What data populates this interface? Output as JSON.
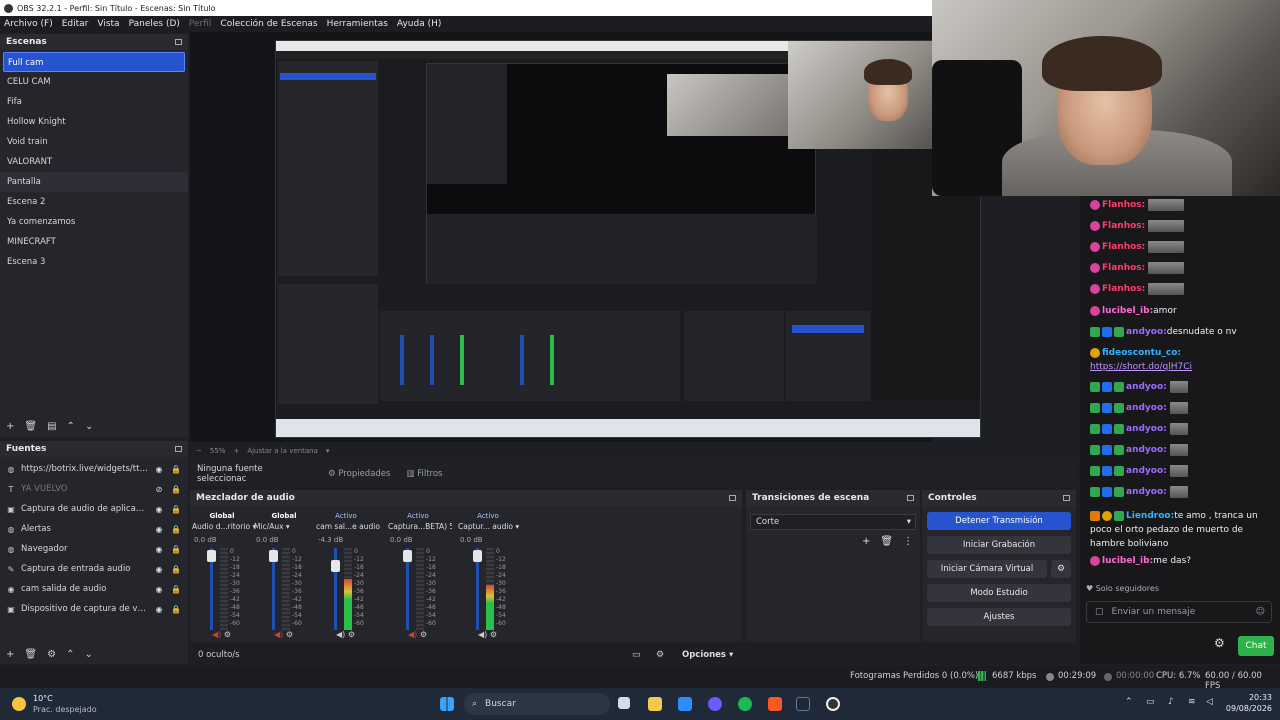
{
  "window": {
    "title": "OBS 32.2.1 - Perfil: Sin Título - Escenas: Sin Título"
  },
  "menu": [
    {
      "label": "Archivo (F)",
      "dim": false
    },
    {
      "label": "Editar",
      "dim": false
    },
    {
      "label": "Vista",
      "dim": false
    },
    {
      "label": "Paneles (D)",
      "dim": false
    },
    {
      "label": "Perfil",
      "dim": true
    },
    {
      "label": "Colección de Escenas",
      "dim": false
    },
    {
      "label": "Herramientas",
      "dim": false
    },
    {
      "label": "Ayuda (H)",
      "dim": false
    }
  ],
  "scenes": {
    "title": "Escenas",
    "items": [
      "Full cam",
      "CELU CAM",
      "Fifa",
      "Hollow Knight",
      "Void train",
      "VALORANT",
      "Pantalla",
      "Escena 2",
      "Ya comenzamos",
      "MINECRAFT",
      "Escena 3"
    ],
    "selected": "Full cam",
    "hovered": "Pantalla"
  },
  "sources": {
    "title": "Fuentes",
    "items": [
      {
        "label": "https://botrix.live/widgets/tts/?",
        "icon": "globe-icon",
        "visible": true
      },
      {
        "label": "YA VUELVO",
        "icon": "text-icon",
        "visible": false
      },
      {
        "label": "Captura de audio de aplicación (",
        "icon": "app-audio-icon",
        "visible": true
      },
      {
        "label": "Alertas",
        "icon": "globe-icon",
        "visible": true
      },
      {
        "label": "Navegador",
        "icon": "globe-icon",
        "visible": true
      },
      {
        "label": "Captura de entrada audio",
        "icon": "mic-icon",
        "visible": true
      },
      {
        "label": "cam salida de audio",
        "icon": "speaker-icon",
        "visible": true
      },
      {
        "label": "Dispositivo de captura de video",
        "icon": "camera-icon",
        "visible": true
      }
    ]
  },
  "preview": {
    "zoom": "55%",
    "fit_label": "Ajustar a la ventana"
  },
  "context": {
    "no_source": "Ninguna fuente seleccionac",
    "properties": "Propiedades",
    "filters": "Filtros"
  },
  "mixer": {
    "title": "Mezclador de audio",
    "channels": [
      {
        "tag": "Global",
        "name": "Audio d...ritorio",
        "db": "0.0 dB",
        "level": 0.0,
        "muted": true
      },
      {
        "tag": "Global",
        "name": "Mic/Aux",
        "db": "0.0 dB",
        "level": 0.0,
        "muted": true
      },
      {
        "tag": "Activo",
        "name": "cam sal...e audio",
        "db": "-4.3 dB",
        "level": 0.62,
        "muted": false
      },
      {
        "tag": "Activo",
        "name": "Captura...BETA) 5",
        "db": "0.0 dB",
        "level": 0.0,
        "muted": true
      },
      {
        "tag": "Activo",
        "name": "Captur... audio",
        "db": "0.0 dB",
        "level": 0.55,
        "muted": false
      }
    ],
    "scale": [
      "0",
      "-12",
      "-18",
      "-24",
      "-30",
      "-36",
      "-42",
      "-48",
      "-54",
      "-60"
    ],
    "hidden_count": "0 oculto/s",
    "options_label": "Opciones"
  },
  "transitions": {
    "title": "Transiciones de escena",
    "selected": "Corte"
  },
  "controls": {
    "title": "Controles",
    "buttons": [
      "Detener Transmisión",
      "Iniciar Grabación",
      "Iniciar Cámara Virtual",
      "Modo Estudio",
      "Ajustes"
    ]
  },
  "status": {
    "dropped": "Fotogramas Perdidos 0 (0.0%)",
    "bitrate": "6687 kbps",
    "time": "00:29:09",
    "rec_time": "00:00:00",
    "cpu": "CPU: 6.7%",
    "fps": "60.00 / 60.00 FPS"
  },
  "chat": {
    "messages": [
      {
        "user": "Flanhos:",
        "text": "",
        "badges": [
          "pink"
        ],
        "emote": "wide",
        "color": "#ff3b6b"
      },
      {
        "user": "Flanhos:",
        "text": "",
        "badges": [
          "pink"
        ],
        "emote": "wide",
        "color": "#ff3b6b"
      },
      {
        "user": "Flanhos:",
        "text": "",
        "badges": [
          "pink"
        ],
        "emote": "wide",
        "color": "#ff3b6b"
      },
      {
        "user": "Flanhos:",
        "text": "",
        "badges": [
          "pink"
        ],
        "emote": "wide",
        "color": "#ff3b6b"
      },
      {
        "user": "Flanhos:",
        "text": "",
        "badges": [
          "pink"
        ],
        "emote": "wide",
        "color": "#ff3b6b"
      },
      {
        "user": "lucibel_ib:",
        "text": "amor",
        "badges": [
          "pink"
        ],
        "emote": "",
        "color": "#ff6bd6"
      },
      {
        "user": "andyoo:",
        "text": "desnudate o nv",
        "badges": [
          "green",
          "blue",
          "green"
        ],
        "emote": "",
        "color": "#9a6bff"
      },
      {
        "user": "fideoscontu_co:",
        "text": "",
        "badges": [
          "gold"
        ],
        "emote": "",
        "color": "#2fb4ff"
      },
      {
        "user": "andyoo:",
        "text": "",
        "badges": [
          "green",
          "blue",
          "green"
        ],
        "emote": "small",
        "color": "#9a6bff"
      },
      {
        "user": "andyoo:",
        "text": "",
        "badges": [
          "green",
          "blue",
          "green"
        ],
        "emote": "small",
        "color": "#9a6bff"
      },
      {
        "user": "andyoo:",
        "text": "",
        "badges": [
          "green",
          "blue",
          "green"
        ],
        "emote": "small",
        "color": "#9a6bff"
      },
      {
        "user": "andyoo:",
        "text": "",
        "badges": [
          "green",
          "blue",
          "green"
        ],
        "emote": "small",
        "color": "#9a6bff"
      },
      {
        "user": "andyoo:",
        "text": "",
        "badges": [
          "green",
          "blue",
          "green"
        ],
        "emote": "small",
        "color": "#9a6bff"
      },
      {
        "user": "andyoo:",
        "text": "",
        "badges": [
          "green",
          "blue",
          "green"
        ],
        "emote": "small",
        "color": "#9a6bff"
      },
      {
        "user": "Liendroo:",
        "text": "te amo , tranca un poco el orto pedazo de muerto de hambre boliviano",
        "badges": [
          "orange",
          "gold",
          "green"
        ],
        "emote": "",
        "color": "#2fb4ff"
      },
      {
        "user": "lucibel_ib:",
        "text": "me das?",
        "badges": [
          "pink"
        ],
        "emote": "",
        "color": "#ff6bd6"
      }
    ],
    "link": "https://short.do/qlH7Ci",
    "followers_only": "Solo seguidores",
    "input_placeholder": "Enviar un mensaje",
    "chat_button": "Chat"
  },
  "taskbar": {
    "weather_temp": "10°C",
    "weather_desc": "Prac. despejado",
    "search_placeholder": "Buscar",
    "time": "20:33",
    "date": "09/08/2026"
  }
}
